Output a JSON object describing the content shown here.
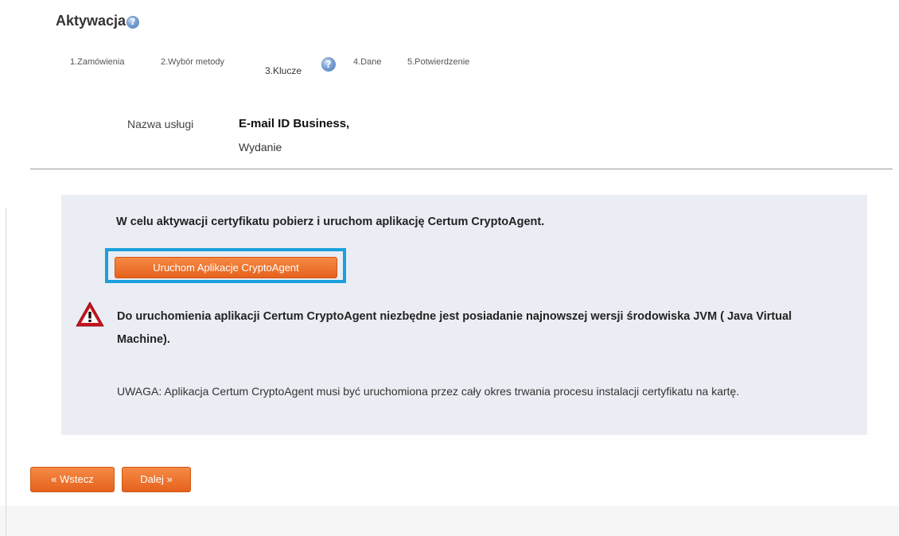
{
  "page": {
    "title": "Aktywacja",
    "help_icon_glyph": "?"
  },
  "steps": [
    {
      "label": "1.Zamówienia",
      "active": false
    },
    {
      "label": "2.Wybór metody",
      "active": false
    },
    {
      "label": "3.Klucze",
      "active": true
    },
    {
      "label": "4.Dane",
      "active": false
    },
    {
      "label": "5.Potwierdzenie",
      "active": false
    }
  ],
  "service": {
    "label": "Nazwa usługi",
    "name": "E-mail ID Business,",
    "subtitle": "Wydanie"
  },
  "panel": {
    "heading": "W celu aktywacji certyfikatu pobierz i uruchom aplikację Certum CryptoAgent.",
    "launch_button": "Uruchom Aplikacje CryptoAgent",
    "warning_icon": "warning-triangle-icon",
    "warning": "Do uruchomienia aplikacji Certum CryptoAgent niezbędne jest posiadanie najnowszej wersji środowiska JVM ( Java Virtual Machine).",
    "note": "UWAGA: Aplikacja Certum CryptoAgent musi być uruchomiona przez cały okres trwania procesu instalacji certyfikatu na kartę."
  },
  "nav": {
    "back": "« Wstecz",
    "next": "Dalej »"
  },
  "colors": {
    "accent_orange": "#e8682a",
    "highlight_blue": "#1aa0dc",
    "panel_bg": "#ebedf4",
    "warning_red": "#c8141e"
  }
}
